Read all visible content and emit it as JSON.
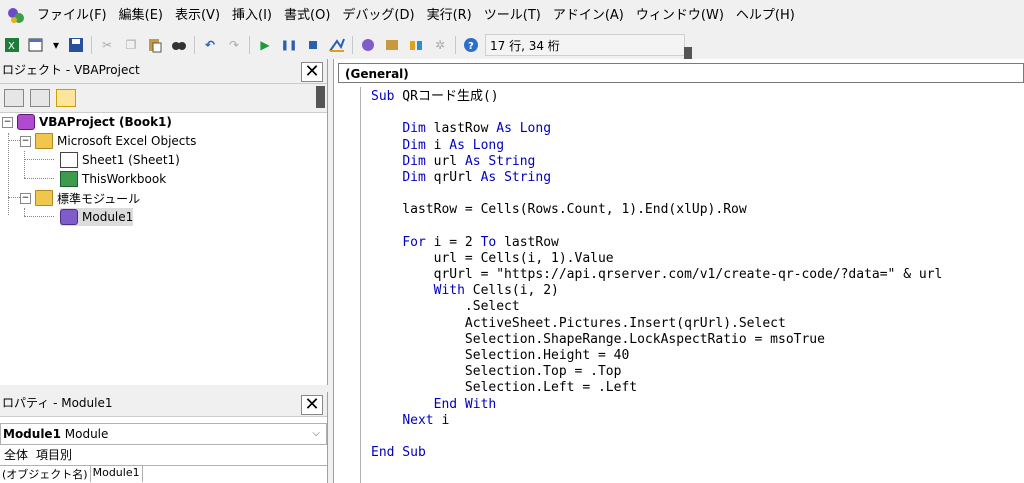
{
  "menu": [
    "ファイル(F)",
    "編集(E)",
    "表示(V)",
    "挿入(I)",
    "書式(O)",
    "デバッグ(D)",
    "実行(R)",
    "ツール(T)",
    "アドイン(A)",
    "ウィンドウ(W)",
    "ヘルプ(H)"
  ],
  "toolbar": {
    "position_readout": "17 行, 34 桁",
    "icons": [
      "excel-view-icon",
      "insert-module-icon",
      "save-icon",
      "cut-icon",
      "copy-icon",
      "paste-icon",
      "find-icon",
      "undo-icon",
      "redo-icon",
      "run-icon",
      "break-icon",
      "reset-icon",
      "design-mode-icon",
      "project-explorer-icon",
      "properties-icon",
      "object-browser-icon",
      "toolbox-icon",
      "help-icon"
    ]
  },
  "project": {
    "title": "ロジェクト - VBAProject",
    "root": "VBAProject (Book1)",
    "excel_objects": "Microsoft Excel Objects",
    "sheet1": "Sheet1 (Sheet1)",
    "thisworkbook": "ThisWorkbook",
    "modules_folder": "標準モジュール",
    "module1": "Module1"
  },
  "properties": {
    "title": "ロパティ - Module1",
    "object_name": "Module1",
    "object_type": "Module",
    "tab_all": "全体",
    "tab_category": "項目別",
    "prop_name": "(オブジェクト名)",
    "prop_value": "Module1"
  },
  "code": {
    "object_combo": "(General)",
    "lines": [
      [
        {
          "t": "Sub",
          "k": true
        },
        {
          "t": " QRコード生成()",
          "k": false
        }
      ],
      [],
      [
        {
          "t": "    ",
          "k": false
        },
        {
          "t": "Dim",
          "k": true
        },
        {
          "t": " lastRow ",
          "k": false
        },
        {
          "t": "As Long",
          "k": true
        }
      ],
      [
        {
          "t": "    ",
          "k": false
        },
        {
          "t": "Dim",
          "k": true
        },
        {
          "t": " i ",
          "k": false
        },
        {
          "t": "As Long",
          "k": true
        }
      ],
      [
        {
          "t": "    ",
          "k": false
        },
        {
          "t": "Dim",
          "k": true
        },
        {
          "t": " url ",
          "k": false
        },
        {
          "t": "As String",
          "k": true
        }
      ],
      [
        {
          "t": "    ",
          "k": false
        },
        {
          "t": "Dim",
          "k": true
        },
        {
          "t": " qrUrl ",
          "k": false
        },
        {
          "t": "As String",
          "k": true
        }
      ],
      [],
      [
        {
          "t": "    lastRow = Cells(Rows.Count, 1).End(xlUp).Row",
          "k": false
        }
      ],
      [],
      [
        {
          "t": "    ",
          "k": false
        },
        {
          "t": "For",
          "k": true
        },
        {
          "t": " i = 2 ",
          "k": false
        },
        {
          "t": "To",
          "k": true
        },
        {
          "t": " lastRow",
          "k": false
        }
      ],
      [
        {
          "t": "        url = Cells(i, 1).Value",
          "k": false
        }
      ],
      [
        {
          "t": "        qrUrl = \"https://api.qrserver.com/v1/create-qr-code/?data=\" & url",
          "k": false
        }
      ],
      [
        {
          "t": "        ",
          "k": false
        },
        {
          "t": "With",
          "k": true
        },
        {
          "t": " Cells(i, 2)",
          "k": false
        }
      ],
      [
        {
          "t": "            .Select",
          "k": false
        }
      ],
      [
        {
          "t": "            ActiveSheet.Pictures.Insert(qrUrl).Select",
          "k": false
        }
      ],
      [
        {
          "t": "            Selection.ShapeRange.LockAspectRatio = msoTrue",
          "k": false
        }
      ],
      [
        {
          "t": "            Selection.Height = 40",
          "k": false
        }
      ],
      [
        {
          "t": "            Selection.Top = .Top",
          "k": false
        }
      ],
      [
        {
          "t": "            Selection.Left = .Left",
          "k": false
        }
      ],
      [
        {
          "t": "        ",
          "k": false
        },
        {
          "t": "End With",
          "k": true
        }
      ],
      [
        {
          "t": "    ",
          "k": false
        },
        {
          "t": "Next",
          "k": true
        },
        {
          "t": " i",
          "k": false
        }
      ],
      [],
      [
        {
          "t": "End Sub",
          "k": true
        }
      ]
    ]
  },
  "colors": {
    "keyword": "#0000c0",
    "text": "#000000"
  }
}
